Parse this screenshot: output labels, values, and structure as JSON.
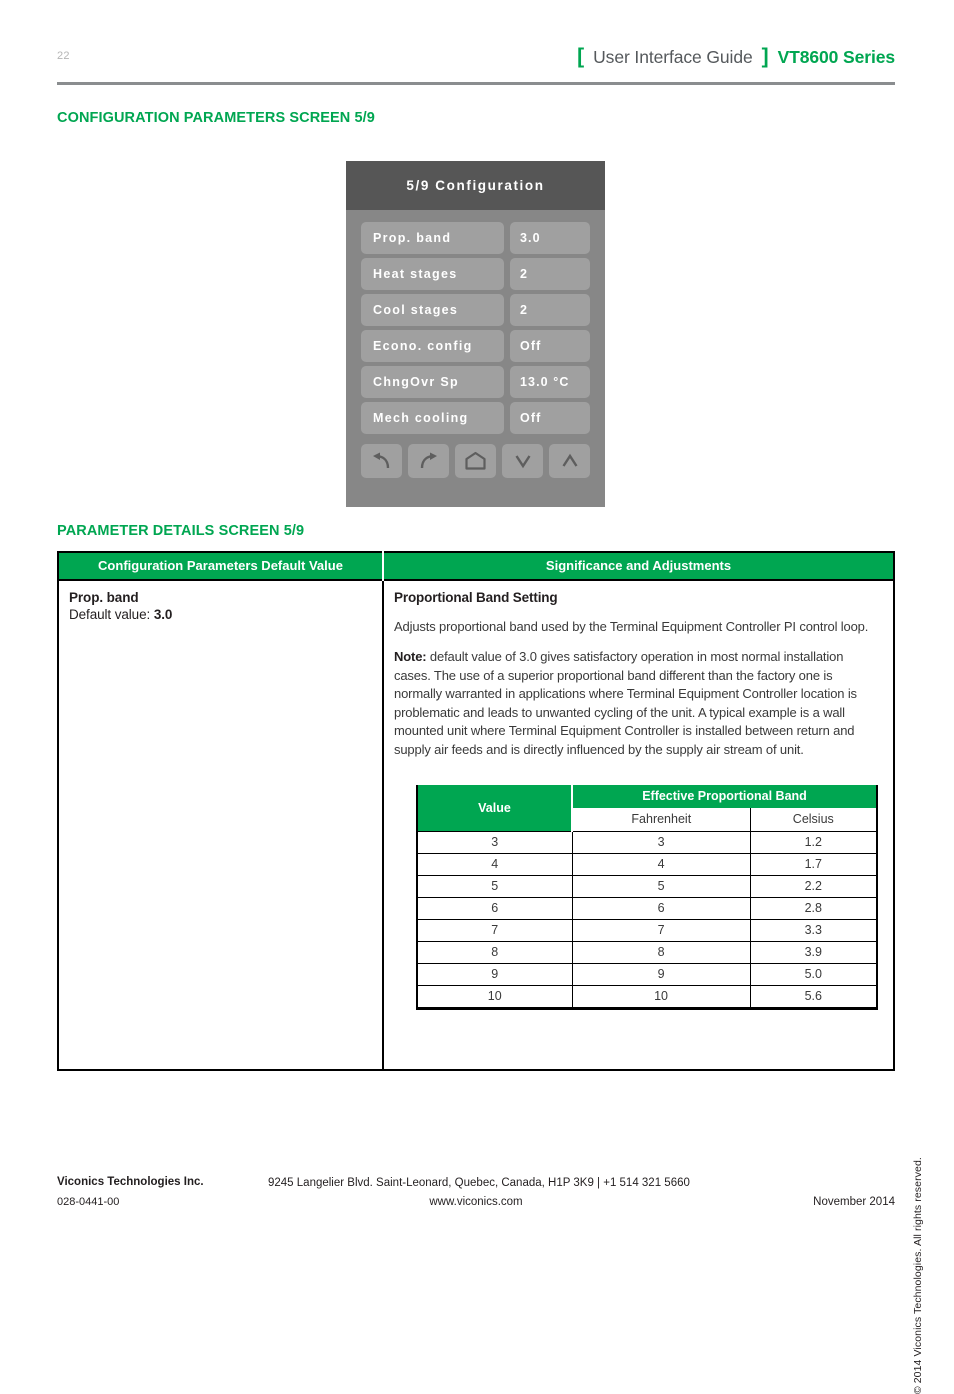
{
  "header": {
    "page_number": "22",
    "bracket_open": "[",
    "bracket_close": "]",
    "guide_title": "User Interface Guide",
    "series_title": "VT8600 Series",
    "accent_green": "#00a651",
    "title_gray": "#55595c"
  },
  "sections": {
    "config_heading": "CONFIGURATION PARAMETERS SCREEN 5/9",
    "details_heading": "PARAMETER DETAILS SCREEN 5/9"
  },
  "device": {
    "title": "5/9 Configuration",
    "titlebar_color": "#565656",
    "body_color": "#878787",
    "button_color": "#a0a0a0",
    "rows": [
      {
        "label": "Prop. band",
        "value": "3.0"
      },
      {
        "label": "Heat stages",
        "value": "2"
      },
      {
        "label": "Cool stages",
        "value": "2"
      },
      {
        "label": "Econo. config",
        "value": "Off"
      },
      {
        "label": "ChngOvr Sp",
        "value": "13.0 °C"
      },
      {
        "label": "Mech cooling",
        "value": "Off"
      }
    ],
    "nav_buttons": [
      {
        "icon": "undo-arrow-icon",
        "name": "back-button"
      },
      {
        "icon": "redo-arrow-icon",
        "name": "forward-button"
      },
      {
        "icon": "home-icon",
        "name": "home-button"
      },
      {
        "icon": "chevron-down-icon",
        "name": "down-button"
      },
      {
        "icon": "chevron-up-icon",
        "name": "up-button"
      }
    ]
  },
  "details_table": {
    "header_left": "Configuration Parameters Default Value",
    "header_right": "Significance and Adjustments",
    "left_cell": {
      "param_name": "Prop. band",
      "default_label": "Default value: ",
      "default_value": "3.0"
    },
    "right_cell": {
      "title": "Proportional Band Setting",
      "paragraph_1": "Adjusts proportional band used by the Terminal Equipment Controller PI control loop.",
      "note_label": "Note:",
      "note_text": " default value of 3.0 gives satisfactory operation in most normal installation cases. The use of a superior proportional band different than the factory one is normally warranted in applications where Terminal Equipment Controller location is problematic and leads to unwanted cycling of the unit. A typical example is a wall mounted unit where Terminal Equipment Controller is installed between return and supply air feeds and is directly influenced by the supply air stream of unit."
    }
  },
  "band_table": {
    "header_value": "Value",
    "header_band": "Effective Proportional Band",
    "sub_blank": "",
    "sub_fahrenheit": "Fahrenheit",
    "sub_celsius": "Celsius",
    "rows": [
      {
        "value": "3",
        "fahrenheit": "3",
        "celsius": "1.2"
      },
      {
        "value": "4",
        "fahrenheit": "4",
        "celsius": "1.7"
      },
      {
        "value": "5",
        "fahrenheit": "5",
        "celsius": "2.2"
      },
      {
        "value": "6",
        "fahrenheit": "6",
        "celsius": "2.8"
      },
      {
        "value": "7",
        "fahrenheit": "7",
        "celsius": "3.3"
      },
      {
        "value": "8",
        "fahrenheit": "8",
        "celsius": "3.9"
      },
      {
        "value": "9",
        "fahrenheit": "9",
        "celsius": "5.0"
      },
      {
        "value": "10",
        "fahrenheit": "10",
        "celsius": "5.6"
      }
    ]
  },
  "copyright_vertical": "© 2014 Viconics Technologies. All rights reserved.",
  "footer": {
    "company": "Viconics Technologies Inc.",
    "doc_number": "028-0441-00",
    "address": "9245 Langelier Blvd. Saint-Leonard, Quebec, Canada, H1P 3K9   |  +1 514 321 5660",
    "website": "www.viconics.com",
    "date": "November 2014"
  }
}
